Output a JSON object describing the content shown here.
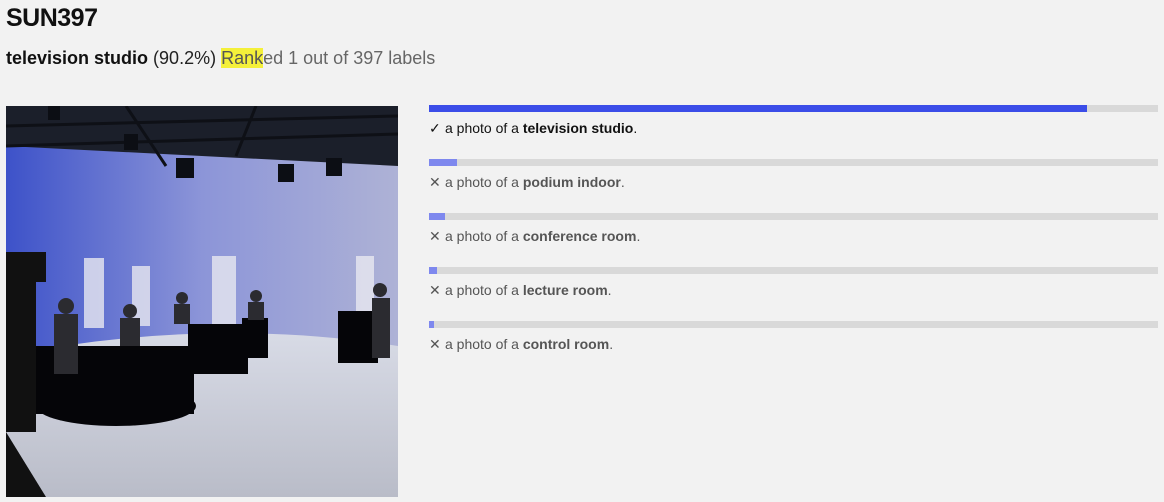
{
  "dataset": "SUN397",
  "prediction": {
    "label": "television studio",
    "confidence": "(90.2%)",
    "rank_highlight": "Rank",
    "rank_rest": "ed 1 out of 397 labels"
  },
  "photo": {
    "description_icon": "photo-image"
  },
  "results": [
    {
      "mark": "✓",
      "prefix": "a photo of a ",
      "label": "television studio",
      "suffix": ".",
      "score": 0.902,
      "color": "#3b4de8",
      "correct": true
    },
    {
      "mark": "✕",
      "prefix": "a photo of a ",
      "label": "podium indoor",
      "suffix": ".",
      "score": 0.039,
      "color": "#7e88ee",
      "correct": false
    },
    {
      "mark": "✕",
      "prefix": "a photo of a ",
      "label": "conference room",
      "suffix": ".",
      "score": 0.022,
      "color": "#7e88ee",
      "correct": false
    },
    {
      "mark": "✕",
      "prefix": "a photo of a ",
      "label": "lecture room",
      "suffix": ".",
      "score": 0.011,
      "color": "#7e88ee",
      "correct": false
    },
    {
      "mark": "✕",
      "prefix": "a photo of a ",
      "label": "control room",
      "suffix": ".",
      "score": 0.007,
      "color": "#7e88ee",
      "correct": false
    }
  ]
}
